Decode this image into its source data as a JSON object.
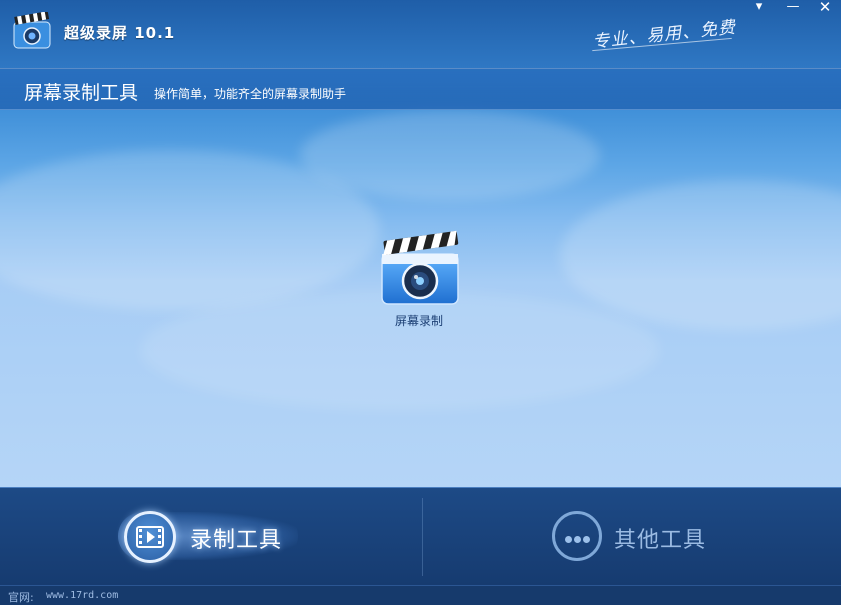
{
  "window": {
    "title": "超级录屏 10.1",
    "slogan": "专业、易用、免费",
    "buttons": {
      "menu": "▾",
      "minimize": "—",
      "close": "✕"
    }
  },
  "header": {
    "title": "屏幕录制工具",
    "subtitle": "操作简单，功能齐全的屏幕录制助手"
  },
  "tools": [
    {
      "label": "屏幕录制",
      "icon": "clapperboard-camera-icon"
    }
  ],
  "nav": {
    "record": {
      "label": "录制工具",
      "icon": "film-icon",
      "active": true
    },
    "other": {
      "label": "其他工具",
      "icon": "more-dots-icon",
      "active": false
    }
  },
  "status": {
    "label": "官网:",
    "url": "www.17rd.com"
  },
  "colors": {
    "sky_top": "#1f5ea8",
    "sky_bottom": "#b5d5f7",
    "bottom_bar": "#163b70",
    "nav_inactive": "#9bbbe3",
    "tool_label": "#1c3f74"
  }
}
